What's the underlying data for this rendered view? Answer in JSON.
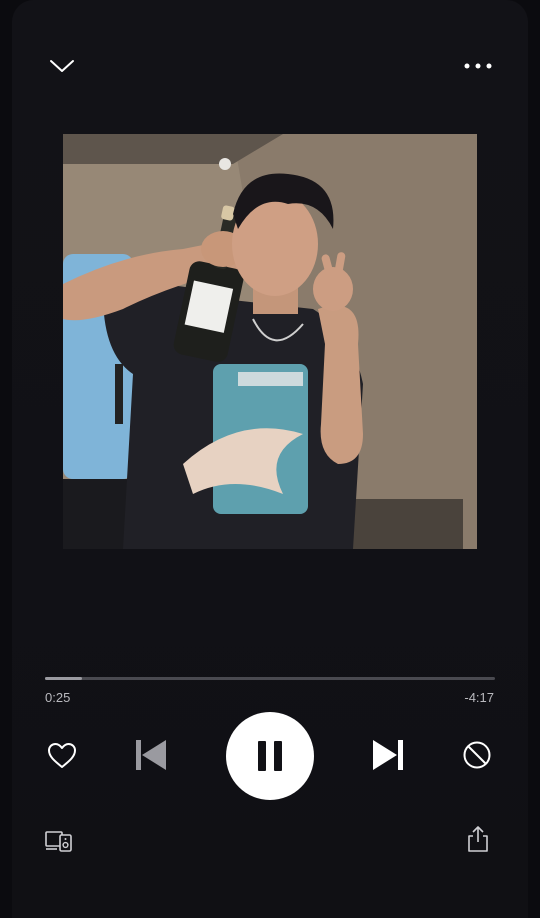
{
  "player": {
    "elapsed": "0:25",
    "remaining": "-4:17",
    "progress_fraction": 0.083,
    "state": "playing"
  },
  "icons": {
    "collapse": "chevron-down-icon",
    "more": "more-horizontal-icon",
    "like": "heart-icon",
    "previous": "skip-previous-icon",
    "pause": "pause-icon",
    "next": "skip-next-icon",
    "hide": "block-icon",
    "devices": "devices-icon",
    "share": "share-icon"
  },
  "colors": {
    "background": "#111116",
    "accent": "#ffffff",
    "track": "#4a4a50",
    "track_fill": "#9b9ba1"
  }
}
